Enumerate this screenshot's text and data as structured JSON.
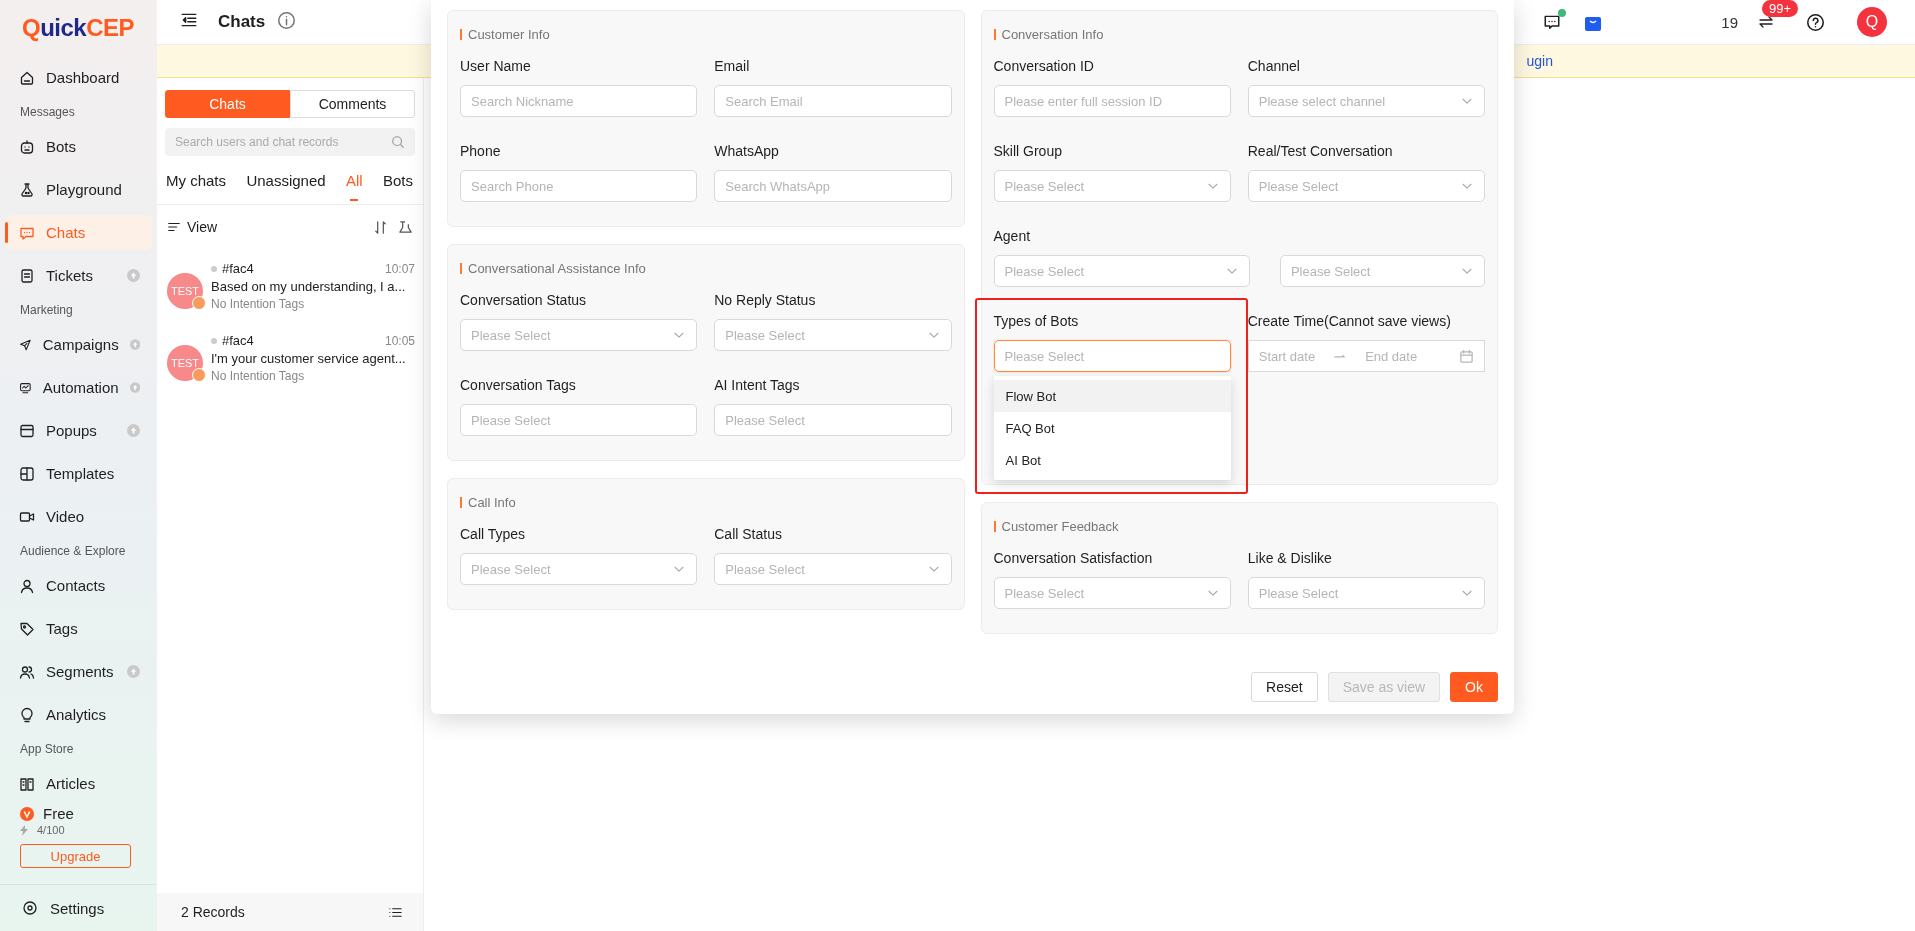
{
  "sidebar": {
    "logo": {
      "mark": "Q",
      "name": "uick",
      "accent": "CEP"
    },
    "items": [
      {
        "kind": "item",
        "label": "Dashboard",
        "selected": false,
        "upgrade": false
      },
      {
        "kind": "section",
        "label": "Messages"
      },
      {
        "kind": "item",
        "label": "Bots",
        "selected": false,
        "upgrade": false
      },
      {
        "kind": "item",
        "label": "Playground",
        "selected": false,
        "upgrade": false
      },
      {
        "kind": "item",
        "label": "Chats",
        "selected": true,
        "upgrade": false
      },
      {
        "kind": "item",
        "label": "Tickets",
        "selected": false,
        "upgrade": true
      },
      {
        "kind": "section",
        "label": "Marketing"
      },
      {
        "kind": "item",
        "label": "Campaigns",
        "selected": false,
        "upgrade": true
      },
      {
        "kind": "item",
        "label": "Automation",
        "selected": false,
        "upgrade": true
      },
      {
        "kind": "item",
        "label": "Popups",
        "selected": false,
        "upgrade": true
      },
      {
        "kind": "item",
        "label": "Templates",
        "selected": false,
        "upgrade": false
      },
      {
        "kind": "item",
        "label": "Video",
        "selected": false,
        "upgrade": false
      },
      {
        "kind": "section",
        "label": "Audience & Explore"
      },
      {
        "kind": "item",
        "label": "Contacts",
        "selected": false,
        "upgrade": false
      },
      {
        "kind": "item",
        "label": "Tags",
        "selected": false,
        "upgrade": false
      },
      {
        "kind": "item",
        "label": "Segments",
        "selected": false,
        "upgrade": true
      },
      {
        "kind": "item",
        "label": "Analytics",
        "selected": false,
        "upgrade": false
      },
      {
        "kind": "section",
        "label": "App Store"
      },
      {
        "kind": "item",
        "label": "Articles",
        "selected": false,
        "upgrade": false
      }
    ],
    "plan": {
      "name": "Free",
      "usage": "4/100",
      "button": "Upgrade"
    },
    "settings": "Settings"
  },
  "header": {
    "title": "Chats"
  },
  "banner": {
    "link": "ugin"
  },
  "toolbar": {
    "notification_dot": true,
    "count": "19",
    "badge": "99+",
    "avatar": "Q"
  },
  "chat_list": {
    "modes": [
      {
        "label": "Chats",
        "selected": true
      },
      {
        "label": "Comments",
        "selected": false
      }
    ],
    "search": {
      "placeholder": "Search users and chat records"
    },
    "filters": [
      {
        "label": "My chats",
        "selected": false
      },
      {
        "label": "Unassigned",
        "selected": false
      },
      {
        "label": "All",
        "selected": true
      },
      {
        "label": "Bots",
        "selected": false
      }
    ],
    "view": "View",
    "conversations": [
      {
        "avatar": "TEST",
        "id": "#fac4",
        "time": "10:07",
        "preview": "Based on my understanding, I a...",
        "tags": "No Intention Tags"
      },
      {
        "avatar": "TEST",
        "id": "#fac4",
        "time": "10:05",
        "preview": "I'm your customer service agent...",
        "tags": "No Intention Tags"
      }
    ],
    "footer": "2 Records"
  },
  "filter_modal": {
    "columns": [
      {
        "sections": [
          {
            "title": "Customer Info",
            "fields": [
              {
                "label": "User Name",
                "kind": "input",
                "placeholder": "Search Nickname"
              },
              {
                "label": "Email",
                "kind": "input",
                "placeholder": "Search Email"
              },
              {
                "label": "Phone",
                "kind": "input",
                "placeholder": "Search Phone"
              },
              {
                "label": "WhatsApp",
                "kind": "input",
                "placeholder": "Search WhatsApp"
              }
            ]
          },
          {
            "title": "Conversational Assistance Info",
            "fields": [
              {
                "label": "Conversation Status",
                "kind": "select",
                "placeholder": "Please Select"
              },
              {
                "label": "No Reply Status",
                "kind": "select",
                "placeholder": "Please Select"
              },
              {
                "label": "Conversation Tags",
                "kind": "input",
                "placeholder": "Please Select"
              },
              {
                "label": "AI Intent Tags",
                "kind": "input",
                "placeholder": "Please Select"
              }
            ]
          },
          {
            "title": "Call Info",
            "fields": [
              {
                "label": "Call Types",
                "kind": "select",
                "placeholder": "Please Select"
              },
              {
                "label": "Call Status",
                "kind": "select",
                "placeholder": "Please Select"
              }
            ]
          }
        ]
      },
      {
        "sections": [
          {
            "title": "Conversation Info",
            "fields": [
              {
                "label": "Conversation ID",
                "kind": "input",
                "placeholder": "Please enter full session ID"
              },
              {
                "label": "Channel",
                "kind": "select",
                "placeholder": "Please select channel"
              },
              {
                "label": "Skill Group",
                "kind": "select",
                "placeholder": "Please Select"
              },
              {
                "label": "Real/Test Conversation",
                "kind": "select",
                "placeholder": "Please Select"
              },
              {
                "label": "Agent",
                "kind": "select_pair",
                "placeholders": [
                  "Please Select",
                  "Please Select"
                ]
              },
              {
                "label": "Types of Bots",
                "kind": "select",
                "placeholder": "Please Select",
                "focused": true,
                "highlighted": true,
                "options": [
                  {
                    "label": "Flow Bot",
                    "selected": true
                  },
                  {
                    "label": "FAQ Bot",
                    "selected": false
                  },
                  {
                    "label": "AI Bot",
                    "selected": false
                  }
                ]
              },
              {
                "label": "Create Time(Cannot save views)",
                "kind": "date_range",
                "start": "Start date",
                "end": "End date"
              }
            ]
          },
          {
            "title": "Customer Feedback",
            "fields": [
              {
                "label": "Conversation Satisfaction",
                "kind": "select",
                "placeholder": "Please Select"
              },
              {
                "label": "Like & Dislike",
                "kind": "select",
                "placeholder": "Please Select"
              }
            ]
          }
        ]
      }
    ],
    "buttons": [
      {
        "label": "Reset",
        "kind": "default",
        "disabled": false
      },
      {
        "label": "Save as view",
        "kind": "default",
        "disabled": true
      },
      {
        "label": "Ok",
        "kind": "primary",
        "disabled": false
      }
    ]
  }
}
